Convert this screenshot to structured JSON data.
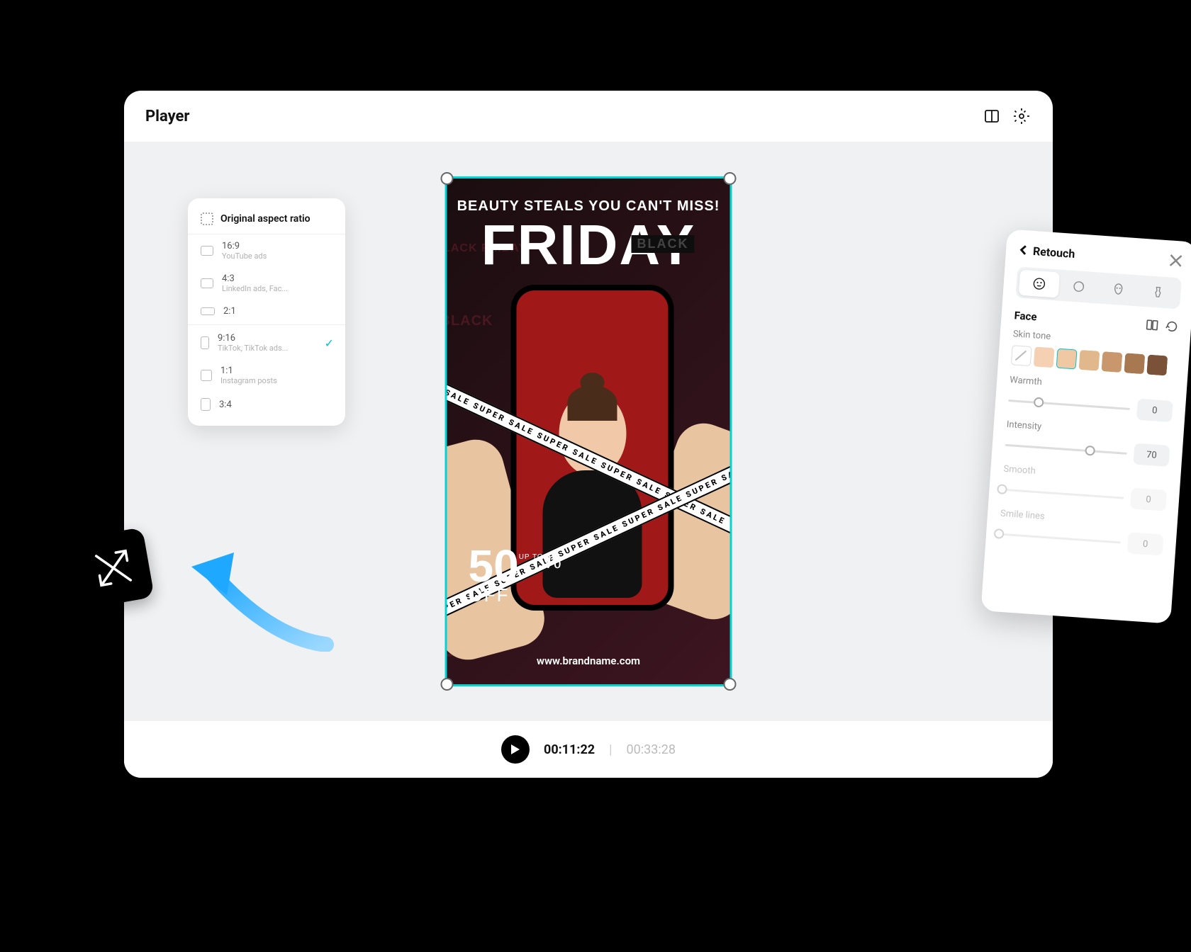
{
  "header": {
    "title": "Player"
  },
  "canvas": {
    "headline1": "BEAUTY STEALS YOU CAN'T MISS!",
    "headline2": "FRIDAY",
    "black_overlay": "BLACK",
    "bg_text": "BLACK FRIDAY",
    "ribbon_text": "SUPER SALE    SUPER SALE    SUPER SALE    SUPER SALE    SUPER SALE",
    "offer_number": "50",
    "offer_upto": "UP TO",
    "offer_pct": "%",
    "offer_off": "OFF",
    "brand_url": "www.brandname.com"
  },
  "aspect_menu": {
    "header": "Original aspect ratio",
    "items": [
      {
        "ratio": "16:9",
        "sub": "YouTube ads"
      },
      {
        "ratio": "4:3",
        "sub": "LinkedIn ads, Fac..."
      },
      {
        "ratio": "2:1",
        "sub": ""
      },
      {
        "ratio": "9:16",
        "sub": "TikTok, TikTok ads...",
        "selected": true
      },
      {
        "ratio": "1:1",
        "sub": "Instagram posts"
      },
      {
        "ratio": "3:4",
        "sub": ""
      }
    ]
  },
  "retouch": {
    "title": "Retouch",
    "section": "Face",
    "skin_tone_label": "Skin tone",
    "swatches": [
      "#ffffff",
      "#f5d0b3",
      "#f0c8a4",
      "#e0b88c",
      "#c8986c",
      "#a87850",
      "#7a5238"
    ],
    "selected_swatch": 2,
    "sliders": [
      {
        "label": "Warmth",
        "value": 0,
        "pos": 25
      },
      {
        "label": "Intensity",
        "value": 70,
        "pos": 70
      },
      {
        "label": "Smooth",
        "value": 0,
        "pos": 0,
        "faded": true
      },
      {
        "label": "Smile lines",
        "value": 0,
        "pos": 0,
        "faded": true
      }
    ]
  },
  "playback": {
    "current": "00:11:22",
    "total": "00:33:28"
  }
}
